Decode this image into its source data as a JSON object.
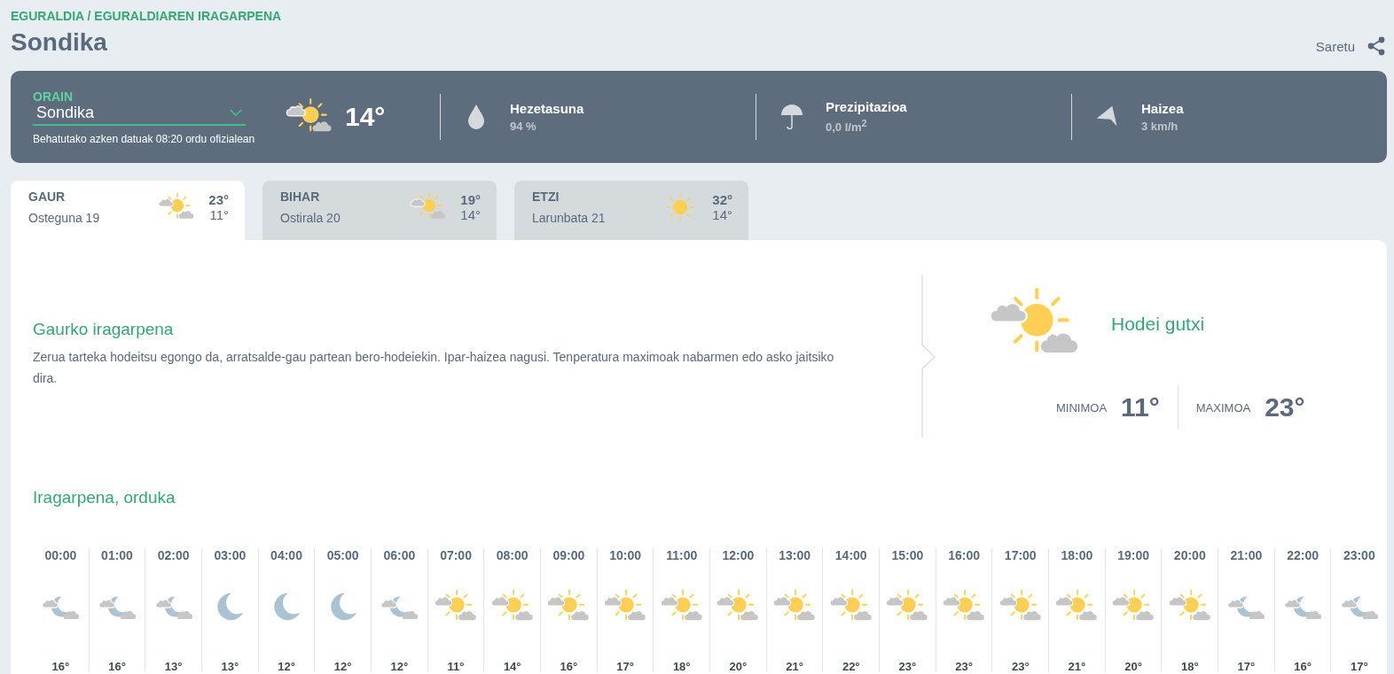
{
  "breadcrumb": "EGURALDIA / EGURALDIAREN IRAGARPENA",
  "title": "Sondika",
  "share": {
    "label": "Saretu"
  },
  "now": {
    "label": "ORAIN",
    "location": "Sondika",
    "note": "Behatutako azken datuak 08:20 ordu ofizialean",
    "kind": "sun-clouds",
    "temp": "14°",
    "stats": [
      {
        "kind": "humidity",
        "label": "Hezetasuna",
        "value": "94 %"
      },
      {
        "kind": "precipitation",
        "label": "Prezipitazioa",
        "value": "0,0 l/m$^{2}$"
      },
      {
        "kind": "wind",
        "label": "Haizea",
        "value": "3 km/h"
      }
    ]
  },
  "tabs": [
    {
      "day": "GAUR",
      "date": "Osteguna 19",
      "kind": "sun-clouds",
      "max": "23°",
      "min": "11°",
      "selected": true
    },
    {
      "day": "BIHAR",
      "date": "Ostirala 20",
      "kind": "sun-clouds",
      "max": "19°",
      "min": "14°",
      "selected": false
    },
    {
      "day": "ETZI",
      "date": "Larunbata 21",
      "kind": "sun",
      "max": "32°",
      "min": "14°",
      "selected": false
    }
  ],
  "forecast": {
    "title": "Gaurko iragarpena",
    "text": "Zerua tarteka hodeitsu egongo da, arratsalde-gau partean bero-hodeiekin. Ipar-haizea nagusi. Tenperatura maximoak nabarmen edo asko jaitsiko dira.",
    "kind": "sun-clouds",
    "summary": "Hodei gutxi",
    "min_label": "MINIMOA",
    "min": "11°",
    "max_label": "MAXIMOA",
    "max": "23°"
  },
  "hourly": {
    "title": "Iragarpena, orduka",
    "hours": [
      {
        "time": "00:00",
        "kind": "moon-clouds",
        "temp": "16°"
      },
      {
        "time": "01:00",
        "kind": "moon-clouds",
        "temp": "16°"
      },
      {
        "time": "02:00",
        "kind": "moon-clouds",
        "temp": "13°"
      },
      {
        "time": "03:00",
        "kind": "moon",
        "temp": "13°"
      },
      {
        "time": "04:00",
        "kind": "moon",
        "temp": "12°"
      },
      {
        "time": "05:00",
        "kind": "moon",
        "temp": "12°"
      },
      {
        "time": "06:00",
        "kind": "moon-clouds",
        "temp": "12°"
      },
      {
        "time": "07:00",
        "kind": "sun-clouds",
        "temp": "11°"
      },
      {
        "time": "08:00",
        "kind": "sun-clouds",
        "temp": "14°"
      },
      {
        "time": "09:00",
        "kind": "sun-clouds",
        "temp": "16°"
      },
      {
        "time": "10:00",
        "kind": "sun-clouds",
        "temp": "17°"
      },
      {
        "time": "11:00",
        "kind": "sun-clouds",
        "temp": "18°"
      },
      {
        "time": "12:00",
        "kind": "sun-clouds",
        "temp": "20°"
      },
      {
        "time": "13:00",
        "kind": "sun-clouds",
        "temp": "21°"
      },
      {
        "time": "14:00",
        "kind": "sun-clouds",
        "temp": "22°"
      },
      {
        "time": "15:00",
        "kind": "sun-clouds",
        "temp": "23°"
      },
      {
        "time": "16:00",
        "kind": "sun-clouds",
        "temp": "23°"
      },
      {
        "time": "17:00",
        "kind": "sun-clouds",
        "temp": "23°"
      },
      {
        "time": "18:00",
        "kind": "sun-clouds",
        "temp": "21°"
      },
      {
        "time": "19:00",
        "kind": "sun-clouds",
        "temp": "20°"
      },
      {
        "time": "20:00",
        "kind": "sun-clouds",
        "temp": "18°"
      },
      {
        "time": "21:00",
        "kind": "moon-clouds",
        "temp": "17°"
      },
      {
        "time": "22:00",
        "kind": "moon-clouds",
        "temp": "16°"
      },
      {
        "time": "23:00",
        "kind": "moon-clouds",
        "temp": "17°"
      }
    ]
  }
}
